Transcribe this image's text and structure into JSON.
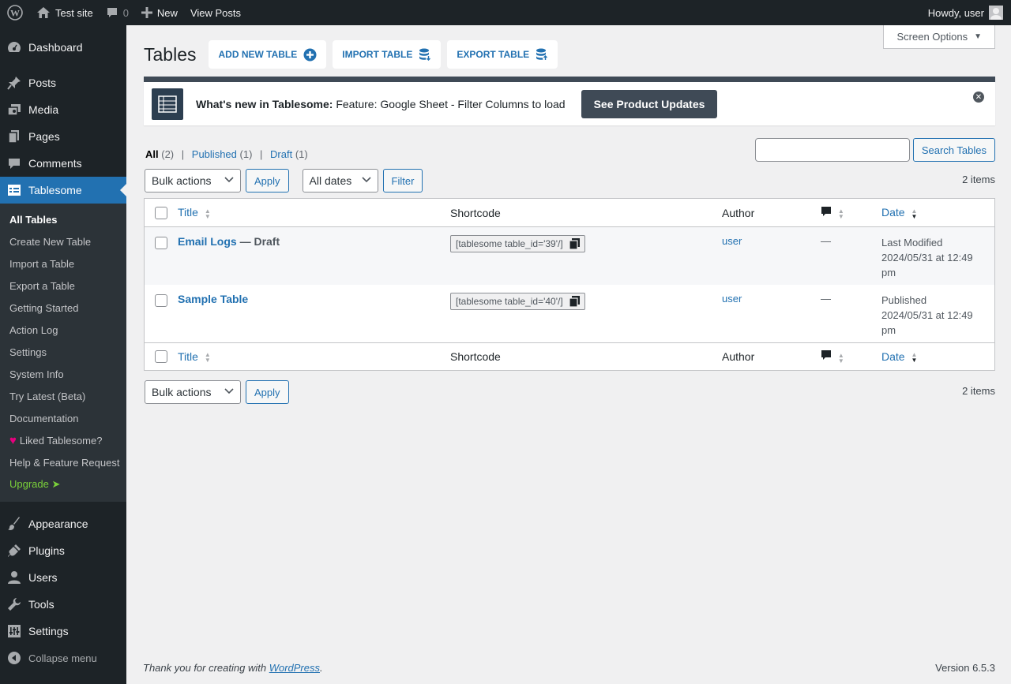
{
  "adminbar": {
    "site_name": "Test site",
    "comments_count": "0",
    "new_label": "New",
    "view_posts_label": "View Posts",
    "howdy": "Howdy, user"
  },
  "sidebar": {
    "items_top": [
      {
        "label": "Dashboard",
        "icon": "dashboard-icon"
      },
      {
        "label": "Posts",
        "icon": "pin-icon"
      },
      {
        "label": "Media",
        "icon": "media-icon"
      },
      {
        "label": "Pages",
        "icon": "pages-icon"
      },
      {
        "label": "Comments",
        "icon": "comment-icon"
      },
      {
        "label": "Tablesome",
        "icon": "table-icon"
      }
    ],
    "submenu": [
      {
        "label": "All Tables"
      },
      {
        "label": "Create New Table"
      },
      {
        "label": "Import a Table"
      },
      {
        "label": "Export a Table"
      },
      {
        "label": "Getting Started"
      },
      {
        "label": "Action Log"
      },
      {
        "label": "Settings"
      },
      {
        "label": "System Info"
      },
      {
        "label": "Try Latest (Beta)"
      },
      {
        "label": "Documentation"
      },
      {
        "label": "Liked Tablesome?"
      },
      {
        "label": "Help & Feature Request"
      },
      {
        "label": "Upgrade ➤"
      }
    ],
    "items_bottom": [
      {
        "label": "Appearance",
        "icon": "brush-icon"
      },
      {
        "label": "Plugins",
        "icon": "plugin-icon"
      },
      {
        "label": "Users",
        "icon": "user-icon"
      },
      {
        "label": "Tools",
        "icon": "wrench-icon"
      },
      {
        "label": "Settings",
        "icon": "settings-icon"
      }
    ],
    "collapse_label": "Collapse menu"
  },
  "screen_options": "Screen Options",
  "page": {
    "title": "Tables",
    "add_new": "ADD NEW TABLE",
    "import": "IMPORT TABLE",
    "export": "EXPORT TABLE"
  },
  "notice": {
    "lead": "What's new in Tablesome:",
    "text": "Feature: Google Sheet - Filter Columns to load",
    "button": "See Product Updates"
  },
  "views": {
    "all": "All",
    "all_count": "(2)",
    "published": "Published",
    "published_count": "(1)",
    "draft": "Draft",
    "draft_count": "(1)",
    "sep": "|"
  },
  "search": {
    "button": "Search Tables",
    "value": ""
  },
  "tablenav": {
    "bulk_actions": "Bulk actions",
    "apply": "Apply",
    "all_dates": "All dates",
    "filter": "Filter",
    "items": "2 items"
  },
  "table": {
    "columns": {
      "title": "Title",
      "shortcode": "Shortcode",
      "author": "Author",
      "date": "Date"
    },
    "rows": [
      {
        "title": "Email Logs",
        "state": " — Draft",
        "shortcode": "[tablesome table_id='39'/]",
        "author": "user",
        "comments": "—",
        "date_status": "Last Modified",
        "date_value": "2024/05/31 at 12:49",
        "date_time": "pm"
      },
      {
        "title": "Sample Table",
        "state": "",
        "shortcode": "[tablesome table_id='40'/]",
        "author": "user",
        "comments": "—",
        "date_status": "Published",
        "date_value": "2024/05/31 at 12:49",
        "date_time": "pm"
      }
    ]
  },
  "footer": {
    "thanks_prefix": "Thank you for creating with ",
    "wordpress": "WordPress",
    "thanks_suffix": ".",
    "version": "Version 6.5.3"
  },
  "colors": {
    "accent": "#2271b1",
    "adminbar": "#1d2327",
    "notice_border": "#3f4a56",
    "upgrade": "#7ad03a",
    "heart": "#e6007e"
  }
}
